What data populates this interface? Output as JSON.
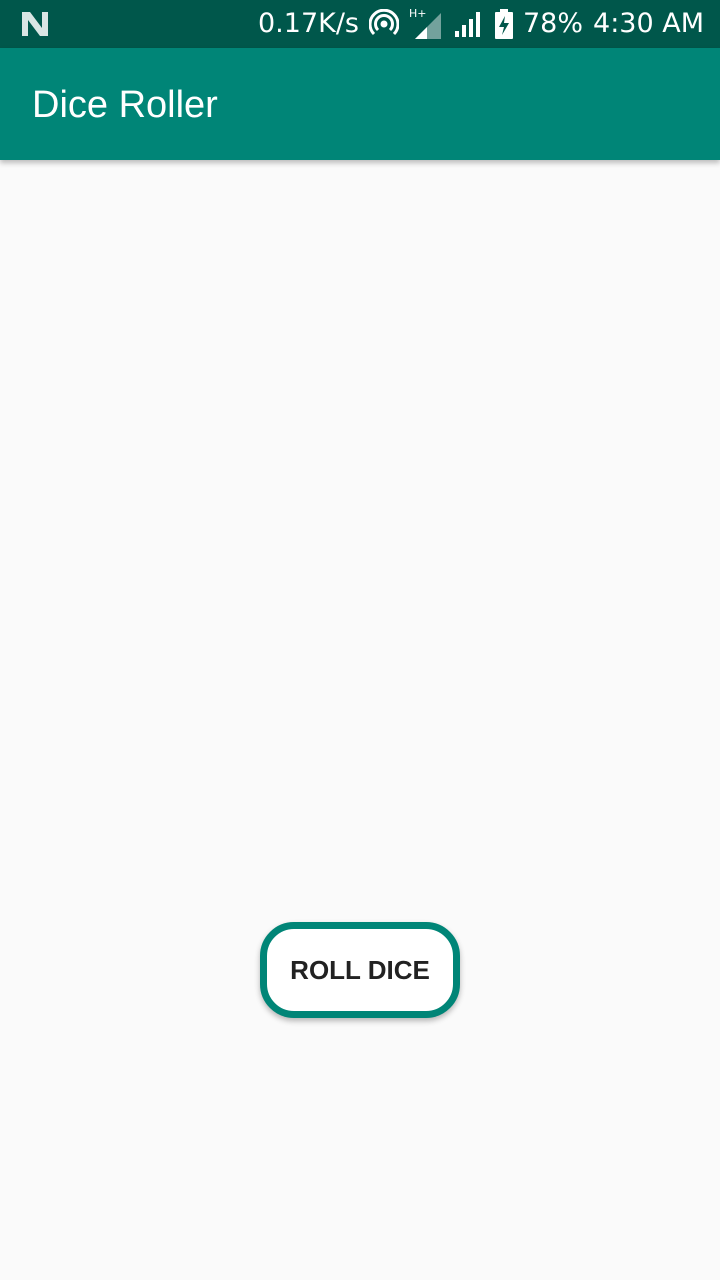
{
  "status_bar": {
    "net_speed": "0.17K/s",
    "battery_percent": "78%",
    "time": "4:30 AM",
    "network_type": "H+",
    "icons": [
      "notification-n-icon",
      "hotspot-icon",
      "signal-sim1-icon",
      "signal-sim2-icon",
      "battery-charging-icon"
    ]
  },
  "app_bar": {
    "title": "Dice Roller",
    "color": "#008577"
  },
  "main": {
    "roll_button_label": "ROLL DICE",
    "button_border_color": "#008577"
  }
}
